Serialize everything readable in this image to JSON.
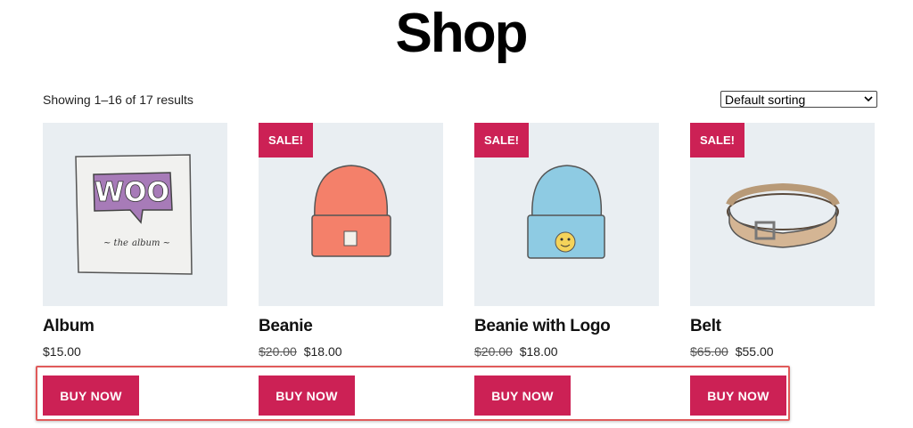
{
  "page": {
    "title": "Shop",
    "result_count": "Showing 1–16 of 17 results",
    "sorting_selected": "Default sorting"
  },
  "colors": {
    "accent": "#cc2155",
    "thumb_bg": "#e9eef2",
    "highlight_border": "#e05a5a"
  },
  "products": [
    {
      "name": "Album",
      "price": "$15.00",
      "regular_price": "",
      "sale": false,
      "sale_label": "",
      "button": "BUY NOW",
      "image_icon": "album-icon"
    },
    {
      "name": "Beanie",
      "price": "$18.00",
      "regular_price": "$20.00",
      "sale": true,
      "sale_label": "SALE!",
      "button": "BUY NOW",
      "image_icon": "beanie-icon"
    },
    {
      "name": "Beanie with Logo",
      "price": "$18.00",
      "regular_price": "$20.00",
      "sale": true,
      "sale_label": "SALE!",
      "button": "BUY NOW",
      "image_icon": "beanie-with-logo-icon"
    },
    {
      "name": "Belt",
      "price": "$55.00",
      "regular_price": "$65.00",
      "sale": true,
      "sale_label": "SALE!",
      "button": "BUY NOW",
      "image_icon": "belt-icon"
    }
  ]
}
